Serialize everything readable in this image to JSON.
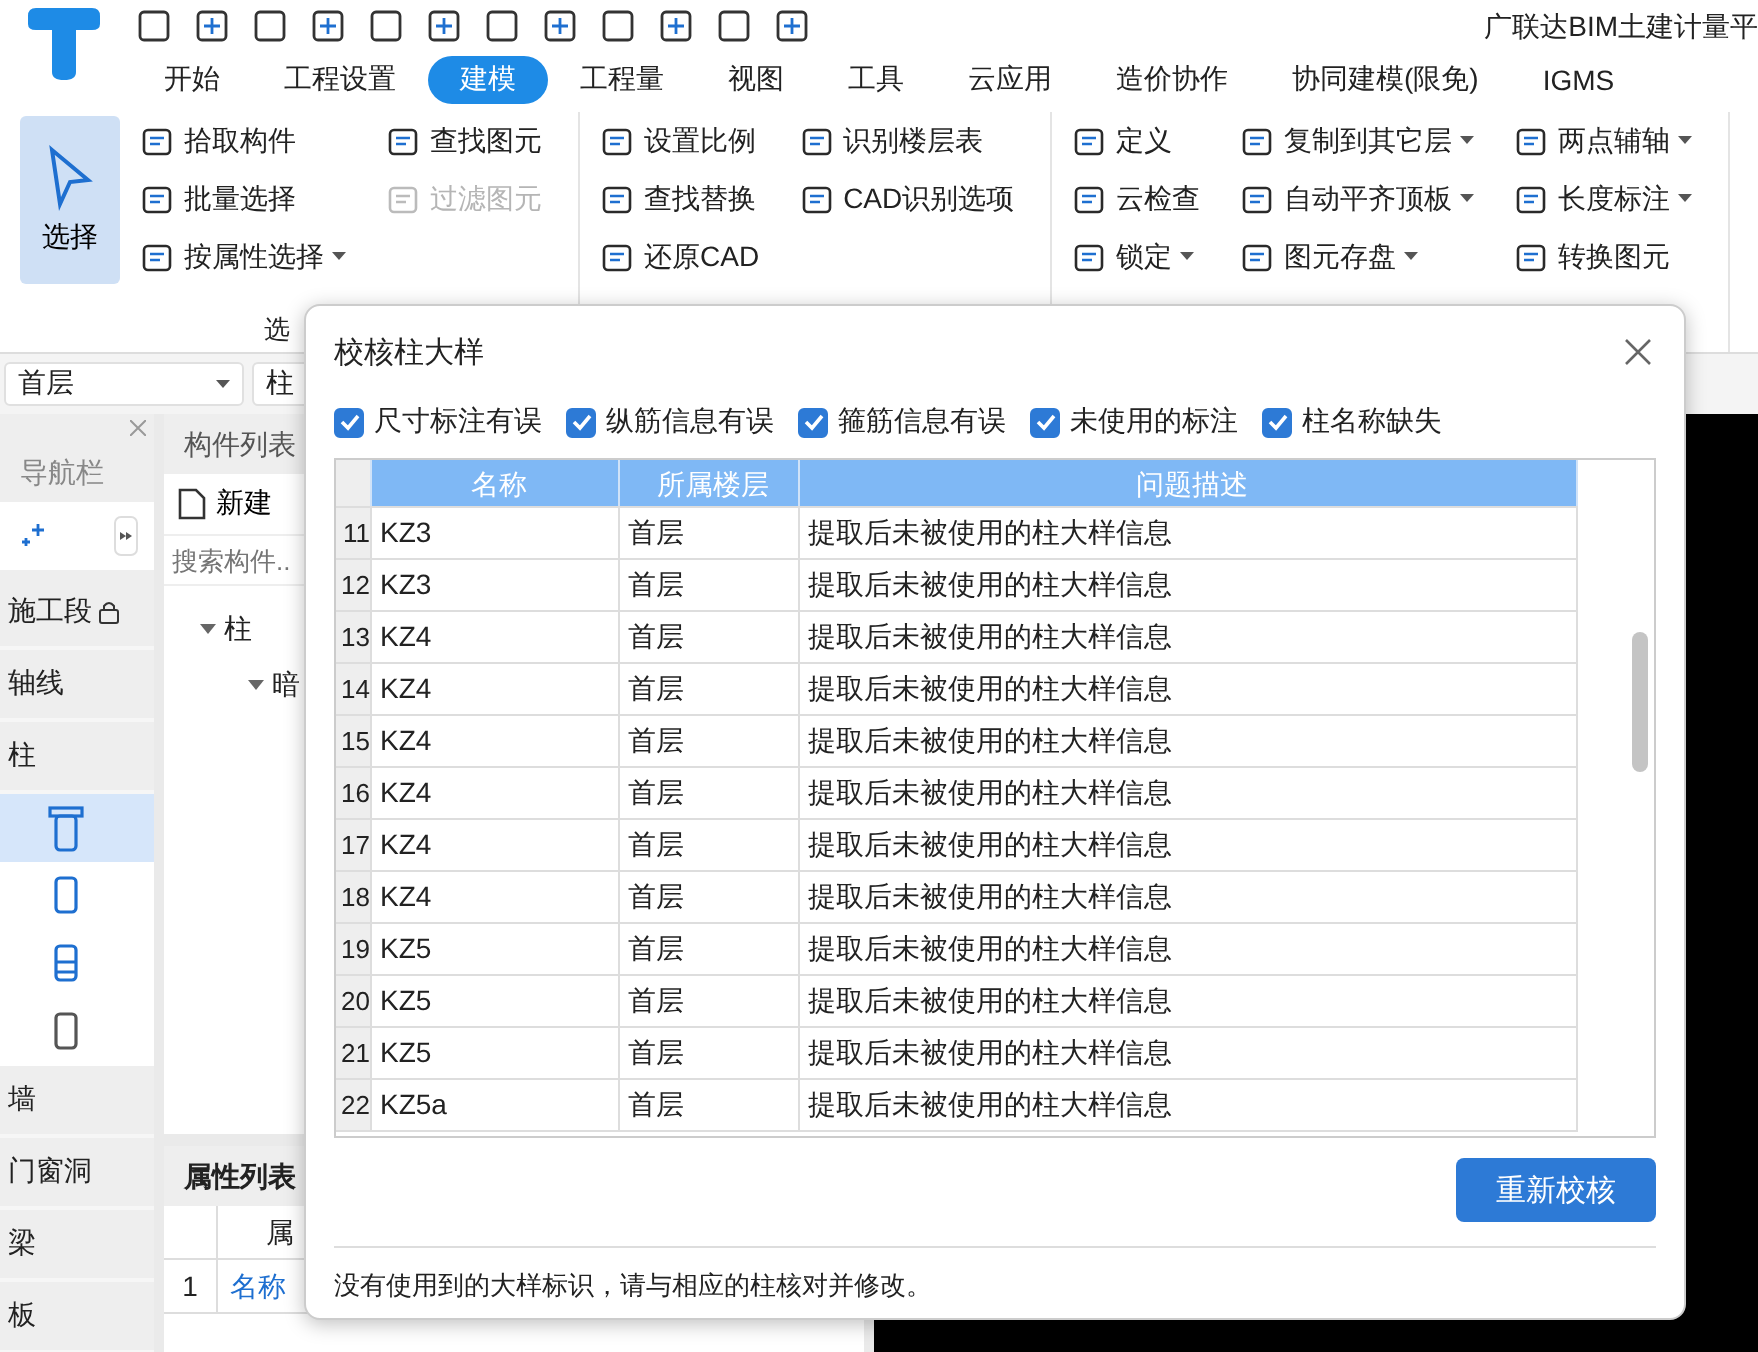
{
  "app_title": "广联达BIM土建计量平",
  "tabs": [
    {
      "label": "开始",
      "selected": false
    },
    {
      "label": "工程设置",
      "selected": false
    },
    {
      "label": "建模",
      "selected": true
    },
    {
      "label": "工程量",
      "selected": false
    },
    {
      "label": "视图",
      "selected": false
    },
    {
      "label": "工具",
      "selected": false
    },
    {
      "label": "云应用",
      "selected": false
    },
    {
      "label": "造价协作",
      "selected": false
    },
    {
      "label": "协同建模(限免)",
      "selected": false
    },
    {
      "label": "IGMS",
      "selected": false
    }
  ],
  "ribbon": {
    "groups": [
      {
        "label": "选",
        "large": {
          "label": "选择",
          "selected": true
        },
        "columns": [
          [
            {
              "label": "拾取构件",
              "disabled": false,
              "dropdown": false
            },
            {
              "label": "批量选择",
              "disabled": false,
              "dropdown": false
            },
            {
              "label": "按属性选择",
              "disabled": false,
              "dropdown": true
            }
          ],
          [
            {
              "label": "查找图元",
              "disabled": false,
              "dropdown": false
            },
            {
              "label": "过滤图元",
              "disabled": true,
              "dropdown": false
            }
          ]
        ]
      },
      {
        "columns": [
          [
            {
              "label": "设置比例",
              "disabled": false,
              "dropdown": false
            },
            {
              "label": "查找替换",
              "disabled": false,
              "dropdown": false
            },
            {
              "label": "还原CAD",
              "disabled": false,
              "dropdown": false
            }
          ],
          [
            {
              "label": "识别楼层表",
              "disabled": false,
              "dropdown": false
            },
            {
              "label": "CAD识别选项",
              "disabled": false,
              "dropdown": false
            }
          ]
        ]
      },
      {
        "columns": [
          [
            {
              "label": "定义",
              "disabled": false,
              "dropdown": false
            },
            {
              "label": "云检查",
              "disabled": false,
              "dropdown": false
            },
            {
              "label": "锁定",
              "disabled": false,
              "dropdown": true
            }
          ],
          [
            {
              "label": "复制到其它层",
              "disabled": false,
              "dropdown": true
            },
            {
              "label": "自动平齐顶板",
              "disabled": false,
              "dropdown": true
            },
            {
              "label": "图元存盘",
              "disabled": false,
              "dropdown": true
            }
          ],
          [
            {
              "label": "两点辅轴",
              "disabled": false,
              "dropdown": true
            },
            {
              "label": "长度标注",
              "disabled": false,
              "dropdown": true
            },
            {
              "label": "转换图元",
              "disabled": false,
              "dropdown": false
            }
          ]
        ]
      }
    ]
  },
  "floor_select": "首层",
  "type_select": "柱",
  "nav": {
    "title": "导航栏",
    "items": [
      {
        "label": "施工段",
        "locked": true
      },
      {
        "label": "轴线",
        "locked": false
      },
      {
        "label": "柱",
        "locked": false,
        "children": [
          {
            "selected": true
          },
          {
            "selected": false
          },
          {
            "selected": false
          },
          {
            "selected": false
          }
        ]
      },
      {
        "label": "墙",
        "locked": false
      },
      {
        "label": "门窗洞",
        "locked": false
      },
      {
        "label": "梁",
        "locked": false
      },
      {
        "label": "板",
        "locked": false
      }
    ]
  },
  "component_list": {
    "title": "构件列表",
    "new_button": "新建",
    "search": {
      "placeholder": "搜索构件.."
    },
    "tree": [
      {
        "label": "柱",
        "expanded": true,
        "children": [
          {
            "label": "暗",
            "expanded": true
          }
        ]
      }
    ]
  },
  "property_list": {
    "title": "属性列表",
    "column_1": "属",
    "rows": [
      {
        "num": "1",
        "name": "名称"
      }
    ]
  },
  "dialog": {
    "title": "校核柱大样",
    "filters": [
      {
        "label": "尺寸标注有误",
        "checked": true
      },
      {
        "label": "纵筋信息有误",
        "checked": true
      },
      {
        "label": "箍筋信息有误",
        "checked": true
      },
      {
        "label": "未使用的标注",
        "checked": true
      },
      {
        "label": "柱名称缺失",
        "checked": true
      }
    ],
    "columns": [
      "名称",
      "所属楼层",
      "问题描述"
    ],
    "rows": [
      {
        "num": "11",
        "name": "KZ3",
        "floor": "首层",
        "desc": "提取后未被使用的柱大样信息"
      },
      {
        "num": "12",
        "name": "KZ3",
        "floor": "首层",
        "desc": "提取后未被使用的柱大样信息"
      },
      {
        "num": "13",
        "name": "KZ4",
        "floor": "首层",
        "desc": "提取后未被使用的柱大样信息"
      },
      {
        "num": "14",
        "name": "KZ4",
        "floor": "首层",
        "desc": "提取后未被使用的柱大样信息"
      },
      {
        "num": "15",
        "name": "KZ4",
        "floor": "首层",
        "desc": "提取后未被使用的柱大样信息"
      },
      {
        "num": "16",
        "name": "KZ4",
        "floor": "首层",
        "desc": "提取后未被使用的柱大样信息"
      },
      {
        "num": "17",
        "name": "KZ4",
        "floor": "首层",
        "desc": "提取后未被使用的柱大样信息"
      },
      {
        "num": "18",
        "name": "KZ4",
        "floor": "首层",
        "desc": "提取后未被使用的柱大样信息"
      },
      {
        "num": "19",
        "name": "KZ5",
        "floor": "首层",
        "desc": "提取后未被使用的柱大样信息"
      },
      {
        "num": "20",
        "name": "KZ5",
        "floor": "首层",
        "desc": "提取后未被使用的柱大样信息"
      },
      {
        "num": "21",
        "name": "KZ5",
        "floor": "首层",
        "desc": "提取后未被使用的柱大样信息"
      },
      {
        "num": "22",
        "name": "KZ5a",
        "floor": "首层",
        "desc": "提取后未被使用的柱大样信息"
      }
    ],
    "button": "重新校核",
    "note": "没有使用到的大样标识，请与相应的柱核对并修改。"
  }
}
